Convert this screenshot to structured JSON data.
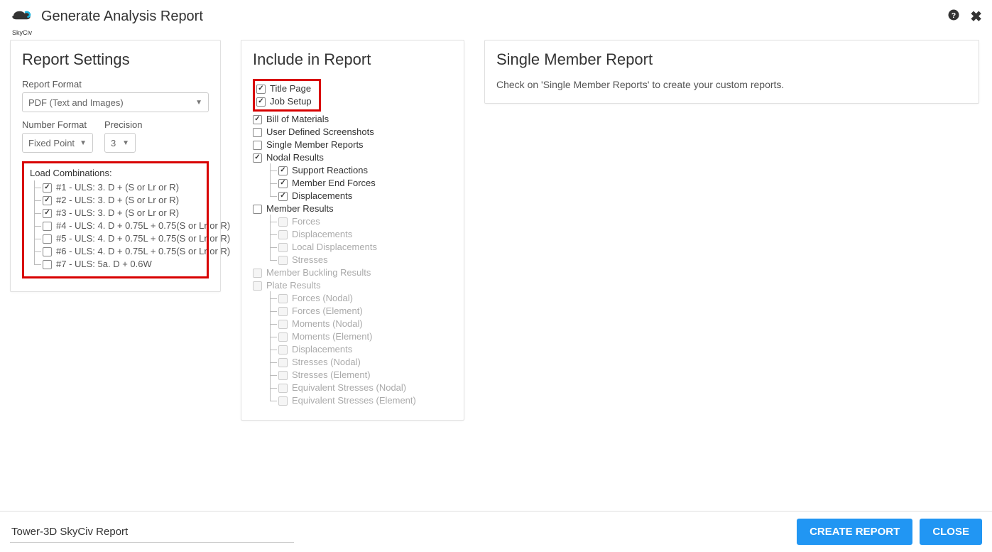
{
  "header": {
    "title": "Generate Analysis Report",
    "logo_text": "SkyCiv"
  },
  "settings": {
    "panel_title": "Report Settings",
    "report_format_label": "Report Format",
    "report_format_value": "PDF (Text and Images)",
    "number_format_label": "Number Format",
    "number_format_value": "Fixed Point",
    "precision_label": "Precision",
    "precision_value": "3",
    "load_combinations_label": "Load Combinations:",
    "load_combinations": [
      {
        "label": "#1 - ULS: 3. D + (S or Lr or R)",
        "checked": true
      },
      {
        "label": "#2 - ULS: 3. D + (S or Lr or R)",
        "checked": true
      },
      {
        "label": "#3 - ULS: 3. D + (S or Lr or R)",
        "checked": true
      },
      {
        "label": "#4 - ULS: 4. D + 0.75L + 0.75(S or Lr or R)",
        "checked": false
      },
      {
        "label": "#5 - ULS: 4. D + 0.75L + 0.75(S or Lr or R)",
        "checked": false
      },
      {
        "label": "#6 - ULS: 4. D + 0.75L + 0.75(S or Lr or R)",
        "checked": false
      },
      {
        "label": "#7 - ULS: 5a. D + 0.6W",
        "checked": false
      }
    ]
  },
  "include": {
    "panel_title": "Include in Report",
    "items": {
      "title_page": "Title Page",
      "job_setup": "Job Setup",
      "bill_of_materials": "Bill of Materials",
      "user_defined_screenshots": "User Defined Screenshots",
      "single_member_reports": "Single Member Reports",
      "nodal_results": "Nodal Results",
      "support_reactions": "Support Reactions",
      "member_end_forces": "Member End Forces",
      "displacements": "Displacements",
      "member_results": "Member Results",
      "forces": "Forces",
      "mr_displacements": "Displacements",
      "local_displacements": "Local Displacements",
      "stresses": "Stresses",
      "member_buckling_results": "Member Buckling Results",
      "plate_results": "Plate Results",
      "forces_nodal": "Forces (Nodal)",
      "forces_element": "Forces (Element)",
      "moments_nodal": "Moments (Nodal)",
      "moments_element": "Moments (Element)",
      "pr_displacements": "Displacements",
      "stresses_nodal": "Stresses (Nodal)",
      "stresses_element": "Stresses (Element)",
      "eq_stresses_nodal": "Equivalent Stresses (Nodal)",
      "eq_stresses_element": "Equivalent Stresses (Element)"
    }
  },
  "single": {
    "panel_title": "Single Member Report",
    "text": "Check on 'Single Member Reports' to create your custom reports."
  },
  "footer": {
    "report_name": "Tower-3D SkyCiv Report",
    "create_button": "CREATE REPORT",
    "close_button": "CLOSE"
  }
}
